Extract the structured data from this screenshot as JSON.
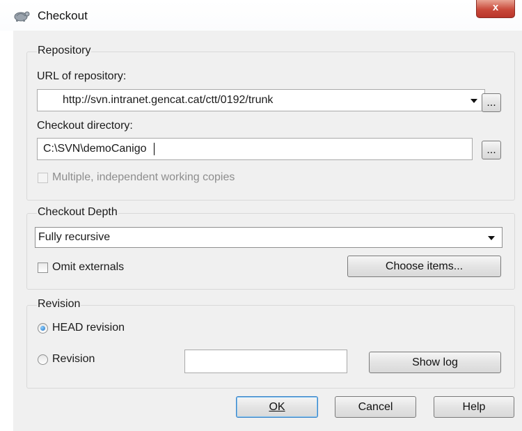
{
  "window": {
    "title": "Checkout",
    "close_symbol": "x"
  },
  "repository": {
    "group_title": "Repository",
    "url_label": "URL of repository:",
    "url_value": "http://svn.intranet.gencat.cat/ctt/0192/trunk",
    "browse_label": "...",
    "dir_label": "Checkout directory:",
    "dir_value": "C:\\SVN\\demoCanigo",
    "multiple_label": "Multiple, independent working copies"
  },
  "depth": {
    "group_title": "Checkout Depth",
    "selected": "Fully recursive",
    "omit_label": "Omit externals",
    "choose_label": "Choose items..."
  },
  "revision": {
    "group_title": "Revision",
    "head_label": "HEAD revision",
    "revision_label": "Revision",
    "revision_value": "",
    "show_log_label": "Show log"
  },
  "buttons": {
    "ok": "OK",
    "cancel": "Cancel",
    "help": "Help"
  }
}
